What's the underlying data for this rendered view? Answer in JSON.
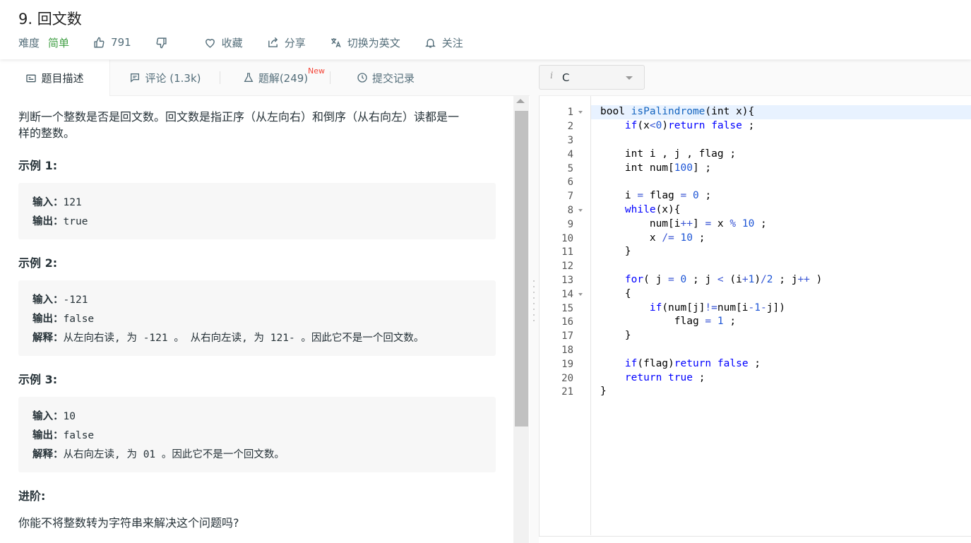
{
  "problem": {
    "title": "9. 回文数",
    "difficulty_label": "难度",
    "difficulty_value": "简单",
    "likes": "791",
    "favorite": "收藏",
    "share": "分享",
    "switch_lang": "切换为英文",
    "follow": "关注"
  },
  "tabs": {
    "description": "题目描述",
    "comments": "评论 (1.3k)",
    "solutions": "题解(249)",
    "solutions_badge": "New",
    "submissions": "提交记录"
  },
  "description": {
    "intro_line1": "判断一个整数是否是回文数。回文数是指正序（从左向右）和倒序（从右向左）读都是一",
    "intro_line2": "样的整数。",
    "examples": [
      {
        "heading": "示例 1:",
        "input_label": "输入：",
        "input": "121",
        "output_label": "输出：",
        "output": "true"
      },
      {
        "heading": "示例 2:",
        "input_label": "输入：",
        "input": "-121",
        "output_label": "输出：",
        "output": "false",
        "explain_label": "解释：",
        "explain": "从左向右读, 为 -121 。 从右向左读, 为 121- 。因此它不是一个回文数。"
      },
      {
        "heading": "示例 3:",
        "input_label": "输入：",
        "input": "10",
        "output_label": "输出：",
        "output": "false",
        "explain_label": "解释：",
        "explain": "从右向左读, 为 01 。因此它不是一个回文数。"
      }
    ],
    "advanced_heading": "进阶:",
    "advanced_text": "你能不将整数转为字符串来解决这个问题吗?"
  },
  "editor": {
    "language": "C",
    "info_glyph": "i",
    "line_numbers": [
      "1",
      "2",
      "3",
      "4",
      "5",
      "6",
      "7",
      "8",
      "9",
      "10",
      "11",
      "12",
      "13",
      "14",
      "15",
      "16",
      "17",
      "18",
      "19",
      "20",
      "21"
    ]
  }
}
